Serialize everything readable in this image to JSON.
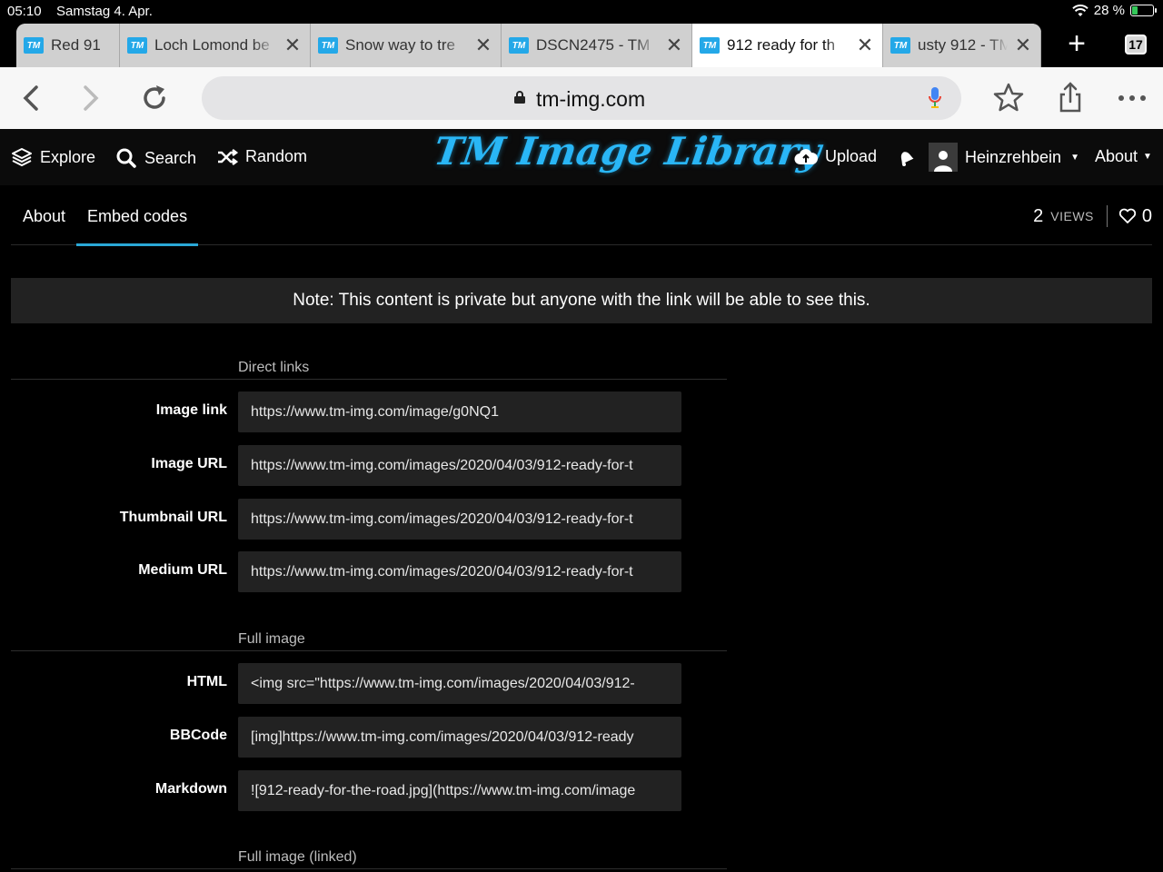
{
  "status": {
    "time": "05:10",
    "date": "Samstag 4. Apr.",
    "battery_text": "28 %",
    "battery_level": 0.28,
    "battery_color": "#34c759"
  },
  "tabs": [
    {
      "title": "Red 91",
      "active": false,
      "has_close": false
    },
    {
      "title": "Loch Lomond be",
      "active": false,
      "has_close": true
    },
    {
      "title": "Snow way to tre",
      "active": false,
      "has_close": true
    },
    {
      "title": "DSCN2475 - TM",
      "active": false,
      "has_close": true
    },
    {
      "title": "912 ready for th",
      "active": true,
      "has_close": true
    },
    {
      "title": "usty 912 - TM I",
      "active": false,
      "has_close": true
    }
  ],
  "tab_favicon_text": "TM",
  "tab_count": "17",
  "address": {
    "url": "tm-img.com"
  },
  "site": {
    "logo_text": "TM Image Library",
    "accent_color": "#29b6f6",
    "nav": {
      "explore": "Explore",
      "search": "Search",
      "random": "Random",
      "upload": "Upload",
      "user": "Heinzrehbein",
      "about": "About"
    }
  },
  "subtabs": {
    "about": "About",
    "embed": "Embed codes",
    "views_count": "2",
    "views_label": "VIEWS",
    "likes_count": "0"
  },
  "note": "Note: This content is private but anyone with the link will be able to see this.",
  "sections": [
    {
      "heading": "Direct links",
      "rows": [
        {
          "label": "Image link",
          "value": "https://www.tm-img.com/image/g0NQ1"
        },
        {
          "label": "Image URL",
          "value": "https://www.tm-img.com/images/2020/04/03/912-ready-for-t"
        },
        {
          "label": "Thumbnail URL",
          "value": "https://www.tm-img.com/images/2020/04/03/912-ready-for-t"
        },
        {
          "label": "Medium URL",
          "value": "https://www.tm-img.com/images/2020/04/03/912-ready-for-t"
        }
      ]
    },
    {
      "heading": "Full image",
      "rows": [
        {
          "label": "HTML",
          "value": "<img src=\"https://www.tm-img.com/images/2020/04/03/912-"
        },
        {
          "label": "BBCode",
          "value": "[img]https://www.tm-img.com/images/2020/04/03/912-ready"
        },
        {
          "label": "Markdown",
          "value": "![912-ready-for-the-road.jpg](https://www.tm-img.com/image"
        }
      ]
    },
    {
      "heading": "Full image (linked)",
      "rows": []
    }
  ]
}
